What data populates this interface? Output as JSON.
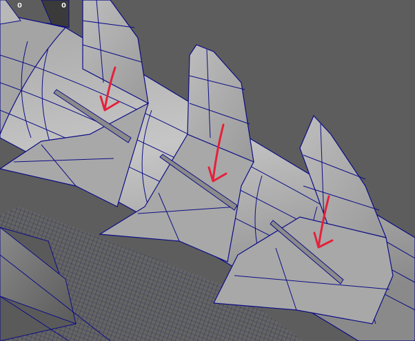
{
  "viewport": {
    "panel": "perspective-viewport",
    "background_color": "#5d5d5d",
    "wire_color": "#0c0c86",
    "surface_color": "#b4b4b4",
    "annotation_color": "#e5203a"
  },
  "hud": {
    "left_readout": "0",
    "right_readout": "0"
  },
  "annotations": {
    "arrow_count": 3,
    "arrow_icon": "red-down-arrow-icon"
  }
}
